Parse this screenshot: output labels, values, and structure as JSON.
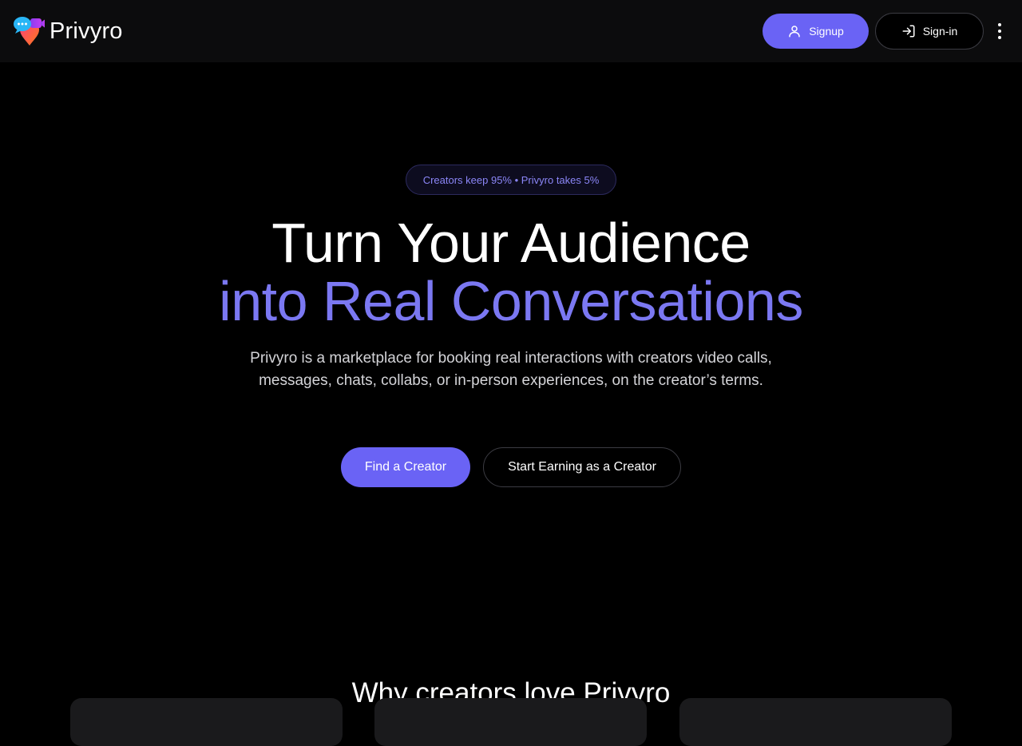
{
  "header": {
    "brand": "Privyro",
    "signup_label": "Signup",
    "signin_label": "Sign-in"
  },
  "hero": {
    "badge": "Creators keep 95% • Privyro takes 5%",
    "title_line1": "Turn Your Audience",
    "title_line2": "into Real Conversations",
    "description": "Privyro is a marketplace for booking real interactions with creators video calls, messages, chats, collabs, or in-person experiences, on the creator’s terms.",
    "primary_cta": "Find a Creator",
    "secondary_cta": "Start Earning as a Creator"
  },
  "features": {
    "title": "Why creators love Privyro"
  },
  "colors": {
    "accent": "#6a63f5",
    "accent_text": "#7b78f2",
    "background": "#000000",
    "navbar": "#0c0c0d"
  },
  "icons": {
    "logo": "chat-location-pin-logo",
    "signup": "user-icon",
    "signin": "sign-in-arrow-icon",
    "menu": "more-vertical-icon"
  }
}
